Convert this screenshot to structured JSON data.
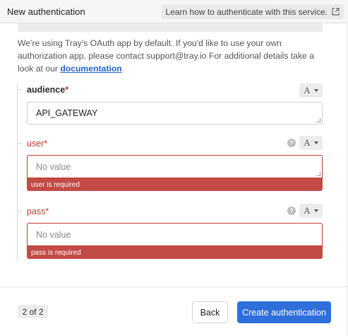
{
  "header": {
    "title": "New authentication",
    "learn_link": "Learn how to authenticate with this service."
  },
  "info": {
    "text": "We're using Tray's OAuth app by default. If you'd like to use your own authorization app, please contact support@tray.io For additional details take a look at our",
    "link": "documentation"
  },
  "fields": [
    {
      "label": "audience",
      "required_mark": "*",
      "type_glyph": "A",
      "value": "API_GATEWAY"
    },
    {
      "label": "user",
      "required_mark": "*",
      "type_glyph": "A",
      "help_glyph": "?",
      "placeholder": "No value",
      "error": "user is required"
    },
    {
      "label": "pass",
      "required_mark": "*",
      "type_glyph": "A",
      "help_glyph": "?",
      "placeholder": "No value",
      "error": "pass is required"
    }
  ],
  "footer": {
    "step": "2 of 2",
    "back_label": "Back",
    "create_label": "Create authentication"
  },
  "colors": {
    "accent": "#2f6fdb",
    "error": "#c0392b",
    "link": "#2563c9"
  }
}
